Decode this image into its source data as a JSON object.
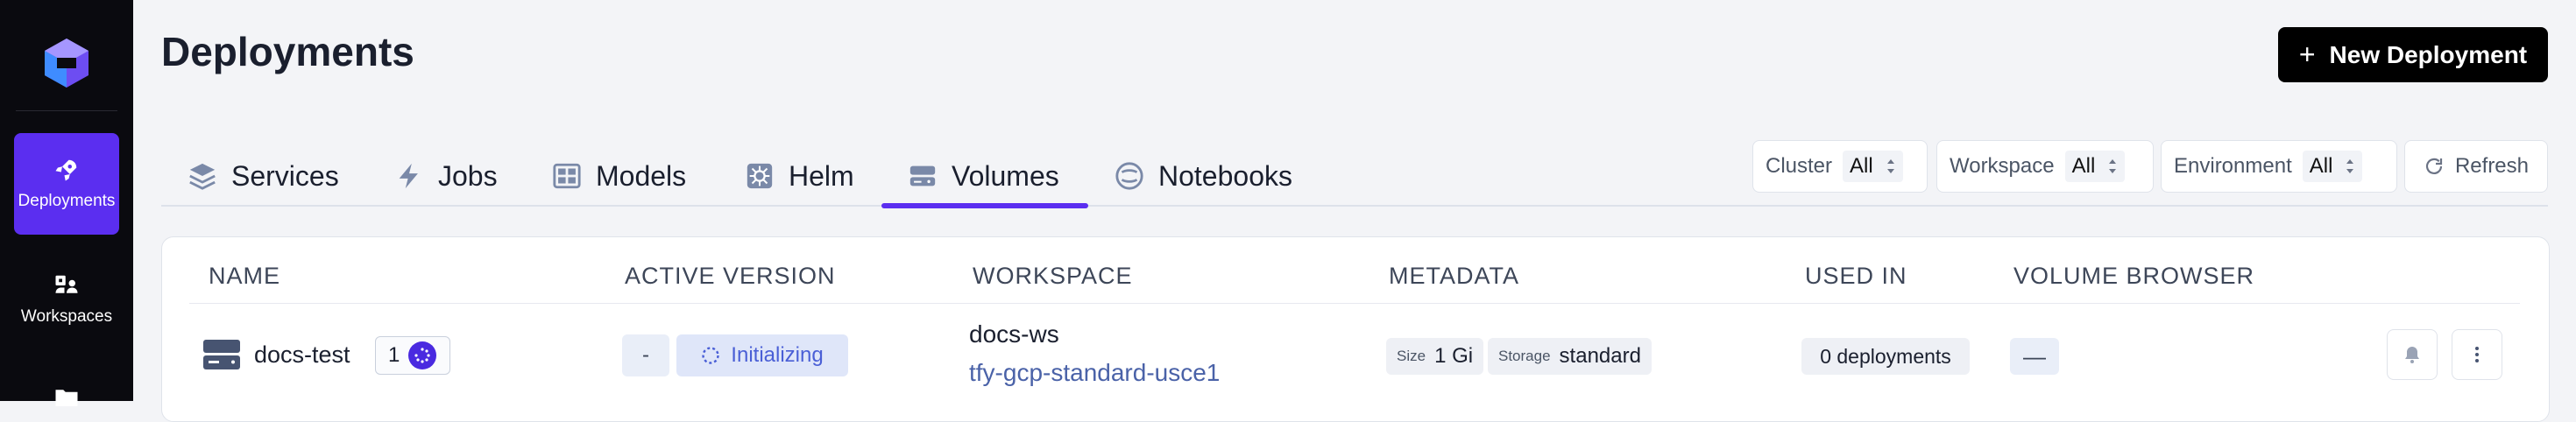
{
  "sidebar": {
    "items": [
      {
        "label": "Deployments",
        "icon": "rocket-icon",
        "active": true
      },
      {
        "label": "Workspaces",
        "icon": "workspaces-icon",
        "active": false
      },
      {
        "label": "",
        "icon": "folder-icon",
        "active": false
      }
    ]
  },
  "header": {
    "title": "Deployments",
    "new_button_icon": "plus-icon",
    "new_button_label": "New Deployment"
  },
  "tabs": [
    {
      "label": "Services",
      "icon": "layers-icon"
    },
    {
      "label": "Jobs",
      "icon": "bolt-icon"
    },
    {
      "label": "Models",
      "icon": "grid-icon"
    },
    {
      "label": "Helm",
      "icon": "helm-icon"
    },
    {
      "label": "Volumes",
      "icon": "storage-icon",
      "active": true
    },
    {
      "label": "Notebooks",
      "icon": "notebook-icon"
    }
  ],
  "filters": [
    {
      "label": "Cluster",
      "value": "All"
    },
    {
      "label": "Workspace",
      "value": "All"
    },
    {
      "label": "Environment",
      "value": "All"
    }
  ],
  "refresh_label": "Refresh",
  "table": {
    "columns": [
      "NAME",
      "ACTIVE VERSION",
      "WORKSPACE",
      "METADATA",
      "USED IN",
      "VOLUME BROWSER"
    ],
    "rows": [
      {
        "name": "docs-test",
        "version_count": "1",
        "active_version": "-",
        "status": "Initializing",
        "workspace": "docs-ws",
        "cluster": "tfy-gcp-standard-usce1",
        "metadata": [
          {
            "key": "Size",
            "value": "1 Gi"
          },
          {
            "key": "Storage",
            "value": "standard"
          }
        ],
        "used_in": "0 deployments",
        "volume_browser": "—"
      }
    ]
  },
  "colors": {
    "accent": "#5b2ef0",
    "sidebar_bg": "#0a0a0f",
    "status_text": "#4a5fd6",
    "link": "#4a62a8"
  }
}
